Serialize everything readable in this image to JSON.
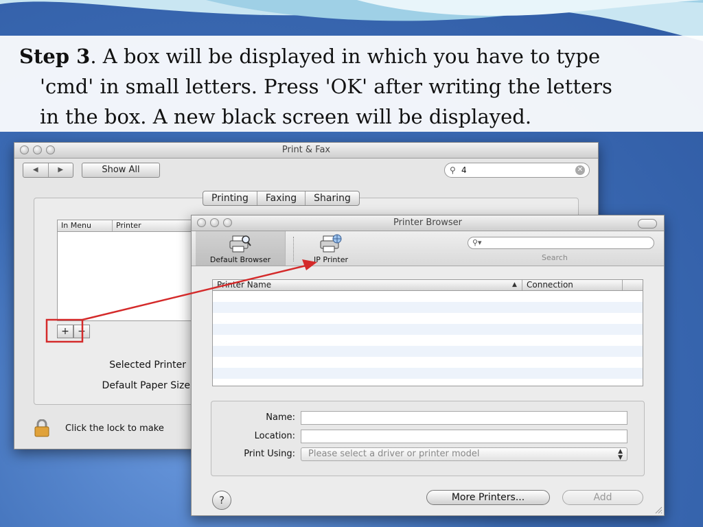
{
  "caption": {
    "step": "Step 3",
    "text1": ". A box will be displayed in which you have to type",
    "text2": "'cmd' in small letters. Press 'OK' after writing the letters",
    "text3": "in the box. A new black screen will be displayed."
  },
  "print_fax": {
    "title": "Print & Fax",
    "nav_back": "◀",
    "nav_forward": "▶",
    "show_all": "Show All",
    "search_value": "4",
    "tabs": [
      "Printing",
      "Faxing",
      "Sharing"
    ],
    "list_headers": [
      "In Menu",
      "Printer"
    ],
    "add_label": "+",
    "remove_label": "−",
    "selected_printer_label": "Selected Printer",
    "default_paper_label": "Default Paper Size",
    "lock_text": "Click the lock to make"
  },
  "printer_browser": {
    "title": "Printer Browser",
    "toolbar": {
      "default_browser": "Default Browser",
      "ip_printer": "IP Printer",
      "search_label": "Search",
      "search_placeholder": ""
    },
    "table": {
      "col_name": "Printer Name",
      "sort_indicator": "▲",
      "col_connection": "Connection"
    },
    "form": {
      "name_label": "Name:",
      "location_label": "Location:",
      "print_using_label": "Print Using:",
      "print_using_value": "Please select a driver or printer model"
    },
    "help": "?",
    "more_printers": "More Printers...",
    "add": "Add"
  },
  "colors": {
    "annotation": "#d42a2a",
    "slide_blue": "#3d6db6"
  }
}
